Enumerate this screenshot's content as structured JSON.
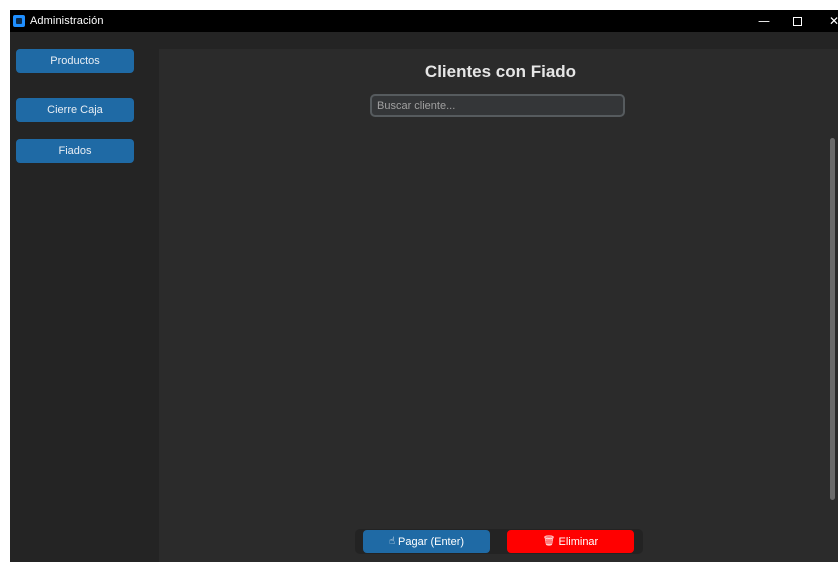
{
  "window": {
    "title": "Administración",
    "icon": "app-icon",
    "controls": {
      "minimize": "—",
      "maximize": "☐",
      "close": "✕"
    }
  },
  "sidebar": {
    "items": [
      {
        "label": "Productos"
      },
      {
        "label": "Cierre Caja"
      },
      {
        "label": "Fiados"
      }
    ]
  },
  "main": {
    "title": "Clientes con Fiado",
    "search": {
      "placeholder": "Buscar cliente...",
      "value": ""
    },
    "list": {
      "items": []
    }
  },
  "footer": {
    "pay_button": {
      "icon": "hand-pointer-icon",
      "icon_glyph": "☝",
      "label": "Pagar (Enter)"
    },
    "delete_button": {
      "icon": "trash-icon",
      "icon_glyph": "🗑",
      "label": "Eliminar"
    }
  },
  "colors": {
    "accent": "#1f6aa5",
    "danger": "#ff0000",
    "panel": "#2b2b2b",
    "background": "#242424"
  }
}
